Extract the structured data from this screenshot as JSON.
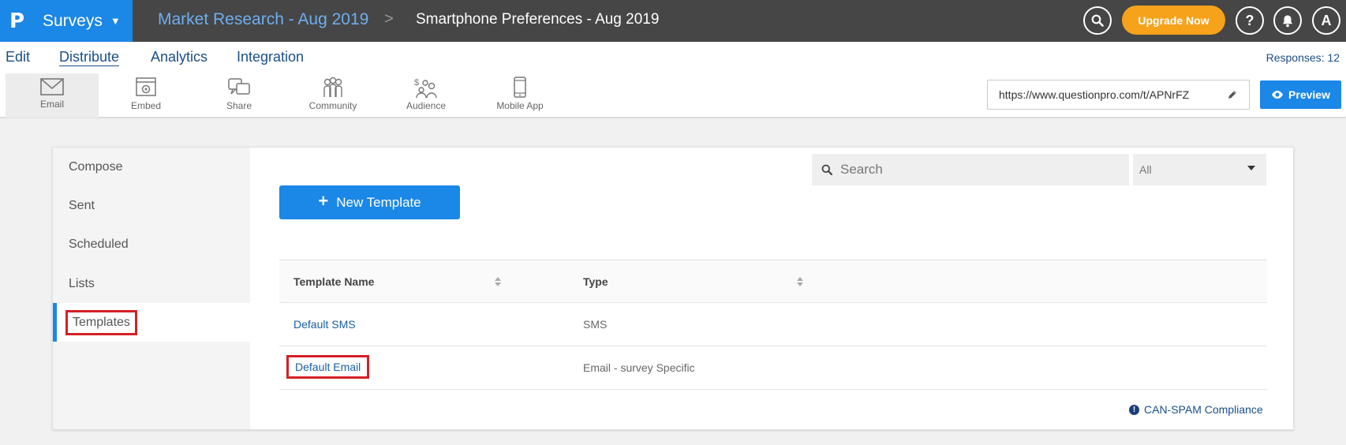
{
  "app": {
    "logo": "P",
    "name": "Surveys"
  },
  "breadcrumb": {
    "parent": "Market Research - Aug 2019",
    "separator": ">",
    "current": "Smartphone Preferences - Aug 2019"
  },
  "header": {
    "upgrade_label": "Upgrade Now",
    "help_glyph": "?",
    "avatar_initial": "A"
  },
  "menu": {
    "items": [
      {
        "label": "Edit",
        "active": false
      },
      {
        "label": "Distribute",
        "active": true
      },
      {
        "label": "Analytics",
        "active": false
      },
      {
        "label": "Integration",
        "active": false
      }
    ],
    "responses": "Responses: 12"
  },
  "toolbar": {
    "tools": [
      {
        "label": "Email",
        "icon": "envelope-icon",
        "active": true
      },
      {
        "label": "Embed",
        "icon": "embed-icon",
        "active": false
      },
      {
        "label": "Share",
        "icon": "share-icon",
        "active": false
      },
      {
        "label": "Community",
        "icon": "community-icon",
        "active": false
      },
      {
        "label": "Audience",
        "icon": "audience-icon",
        "active": false
      },
      {
        "label": "Mobile App",
        "icon": "mobile-icon",
        "active": false
      }
    ],
    "survey_url": "https://www.questionpro.com/t/APNrFZ",
    "preview_label": "Preview"
  },
  "sidebar": {
    "items": [
      {
        "label": "Compose"
      },
      {
        "label": "Sent"
      },
      {
        "label": "Scheduled"
      },
      {
        "label": "Lists"
      },
      {
        "label": "Templates",
        "active": true
      }
    ]
  },
  "main": {
    "search_placeholder": "Search",
    "filter_value": "All",
    "new_template_label": "New Template",
    "table": {
      "columns": [
        "Template Name",
        "Type"
      ],
      "rows": [
        {
          "name": "Default SMS",
          "type": "SMS"
        },
        {
          "name": "Default Email",
          "type": "Email - survey Specific"
        }
      ]
    },
    "compliance_link": "CAN-SPAM Compliance"
  },
  "colors": {
    "brand_blue": "#1b87e6",
    "topbar": "#464646",
    "upgrade_orange": "#f6a21b",
    "highlight_red": "#d61f26"
  }
}
